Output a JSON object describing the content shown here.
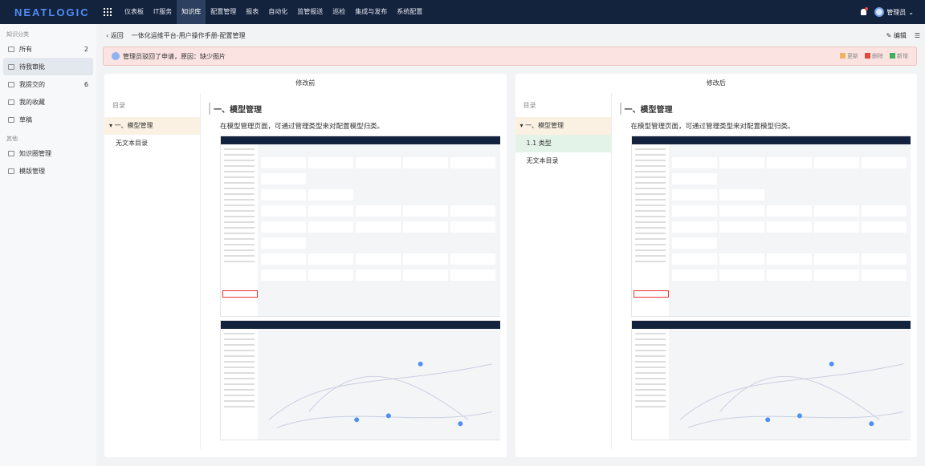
{
  "header": {
    "logo": "NEATLOGIC",
    "nav": [
      "仪表板",
      "IT服务",
      "知识库",
      "配置管理",
      "报表",
      "自动化",
      "监管报送",
      "巡检",
      "集成与发布",
      "系统配置"
    ],
    "active_index": 2,
    "user": "管理员"
  },
  "sidebar": {
    "group1": "知识分类",
    "items": [
      {
        "label": "所有",
        "count": "2"
      },
      {
        "label": "待我审批",
        "count": ""
      },
      {
        "label": "我提交的",
        "count": "6"
      },
      {
        "label": "我的收藏",
        "count": ""
      },
      {
        "label": "草稿",
        "count": ""
      }
    ],
    "group2": "其他",
    "other": [
      {
        "label": "知识圈管理"
      },
      {
        "label": "模版管理"
      }
    ]
  },
  "crumb": {
    "back": "返回",
    "title": "一体化运维平台-用户操作手册-配置管理",
    "edit": "编辑"
  },
  "alert": {
    "text": "管理员驳回了申请，原因：缺少图片",
    "legend": [
      {
        "label": "更新",
        "color": "#f5b25c"
      },
      {
        "label": "删除",
        "color": "#e24b3b"
      },
      {
        "label": "新增",
        "color": "#3fae5e"
      }
    ]
  },
  "before": {
    "title": "修改前",
    "toc_caption": "目录",
    "toc": [
      "一、模型管理",
      "无文本目录"
    ],
    "heading": "一、模型管理",
    "body": "在模型管理页面，可通过管理类型来对配置模型归类。"
  },
  "after": {
    "title": "修改后",
    "toc_caption": "目录",
    "toc": [
      "一、模型管理",
      "1.1 类型",
      "无文本目录"
    ],
    "heading": "一、模型管理",
    "body": "在模型管理页面，可通过管理类型来对配置模型归类。"
  }
}
